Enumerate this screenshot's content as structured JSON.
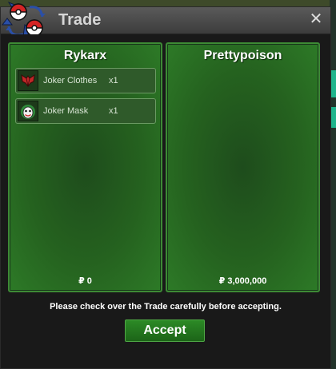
{
  "window": {
    "title": "Trade",
    "close_glyph": "✕",
    "logo_icon": "pokeball-swap-icon"
  },
  "left_trader": {
    "name": "Rykarx",
    "items": [
      {
        "name": "Joker Clothes",
        "qty": "x1",
        "icon": "joker-clothes-icon"
      },
      {
        "name": "Joker Mask",
        "qty": "x1",
        "icon": "joker-mask-icon"
      }
    ],
    "money": "₽ 0"
  },
  "right_trader": {
    "name": "Prettypoison",
    "items": [],
    "money": "₽ 3,000,000"
  },
  "notice": "Please check over the Trade carefully before accepting.",
  "accept_label": "Accept",
  "colors": {
    "panel_green": "#25621f",
    "button_green": "#2c8a26",
    "titlebar": "#4a4a4a"
  }
}
